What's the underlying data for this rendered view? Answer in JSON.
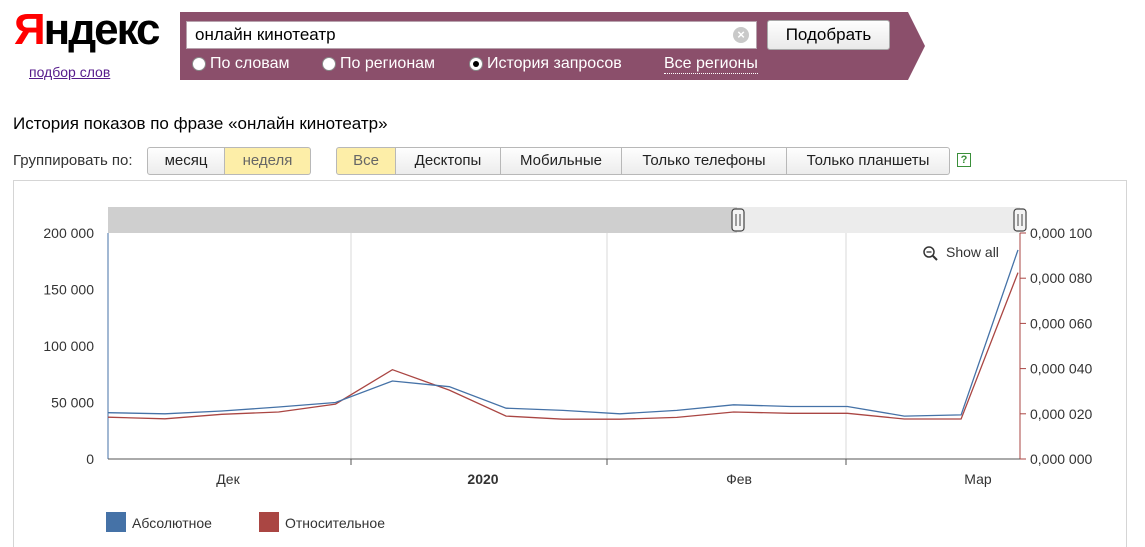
{
  "logo": {
    "first": "Я",
    "rest": "ндекс"
  },
  "wordstat_link": "подбор слов",
  "search": {
    "value": "онлайн кинотеатр",
    "clear_glyph": "×",
    "submit_label": "Подобрать"
  },
  "modes": [
    {
      "label": "По словам",
      "selected": false
    },
    {
      "label": "По регионам",
      "selected": false
    },
    {
      "label": "История запросов",
      "selected": true
    }
  ],
  "regions_link": "Все регионы",
  "page_title": "История показов по фразе «онлайн кинотеатр»",
  "grouping": {
    "label": "Группировать по:",
    "options": [
      "месяц",
      "неделя"
    ],
    "active": "неделя"
  },
  "devices": {
    "options": [
      "Все",
      "Десктопы",
      "Мобильные",
      "Только телефоны",
      "Только планшеты"
    ],
    "active": "Все"
  },
  "help_glyph": "?",
  "colors": {
    "banner": "#8b4f6b",
    "absolute": "#4572a7",
    "relative": "#aa4643"
  },
  "chart_data": {
    "type": "line",
    "show_all_label": "Show all",
    "x_ticks": [
      {
        "label": "Дек",
        "bold": false
      },
      {
        "label": "2020",
        "bold": true
      },
      {
        "label": "Фев",
        "bold": false
      },
      {
        "label": "Мар",
        "bold": false
      }
    ],
    "y_left": {
      "min": 0,
      "max": 200000,
      "ticks": [
        "0",
        "50 000",
        "100 000",
        "150 000",
        "200 000"
      ]
    },
    "y_right": {
      "min": 0,
      "max": 0.0001,
      "ticks": [
        "0,000 000",
        "0,000 020",
        "0,000 040",
        "0,000 060",
        "0,000 080",
        "0,000 100"
      ]
    },
    "series": [
      {
        "name": "Абсолютное",
        "axis": "left",
        "values": [
          41000,
          40000,
          42500,
          46000,
          50000,
          69000,
          64000,
          45000,
          43000,
          40000,
          43000,
          48000,
          46500,
          46500,
          38000,
          39000,
          185000
        ]
      },
      {
        "name": "Относительное",
        "axis": "right",
        "values": [
          1.85e-05,
          1.78e-05,
          1.98e-05,
          2.08e-05,
          2.43e-05,
          3.95e-05,
          3.05e-05,
          1.9e-05,
          1.76e-05,
          1.76e-05,
          1.84e-05,
          2.08e-05,
          2.02e-05,
          2.02e-05,
          1.77e-05,
          1.77e-05,
          8.25e-05
        ]
      }
    ]
  }
}
